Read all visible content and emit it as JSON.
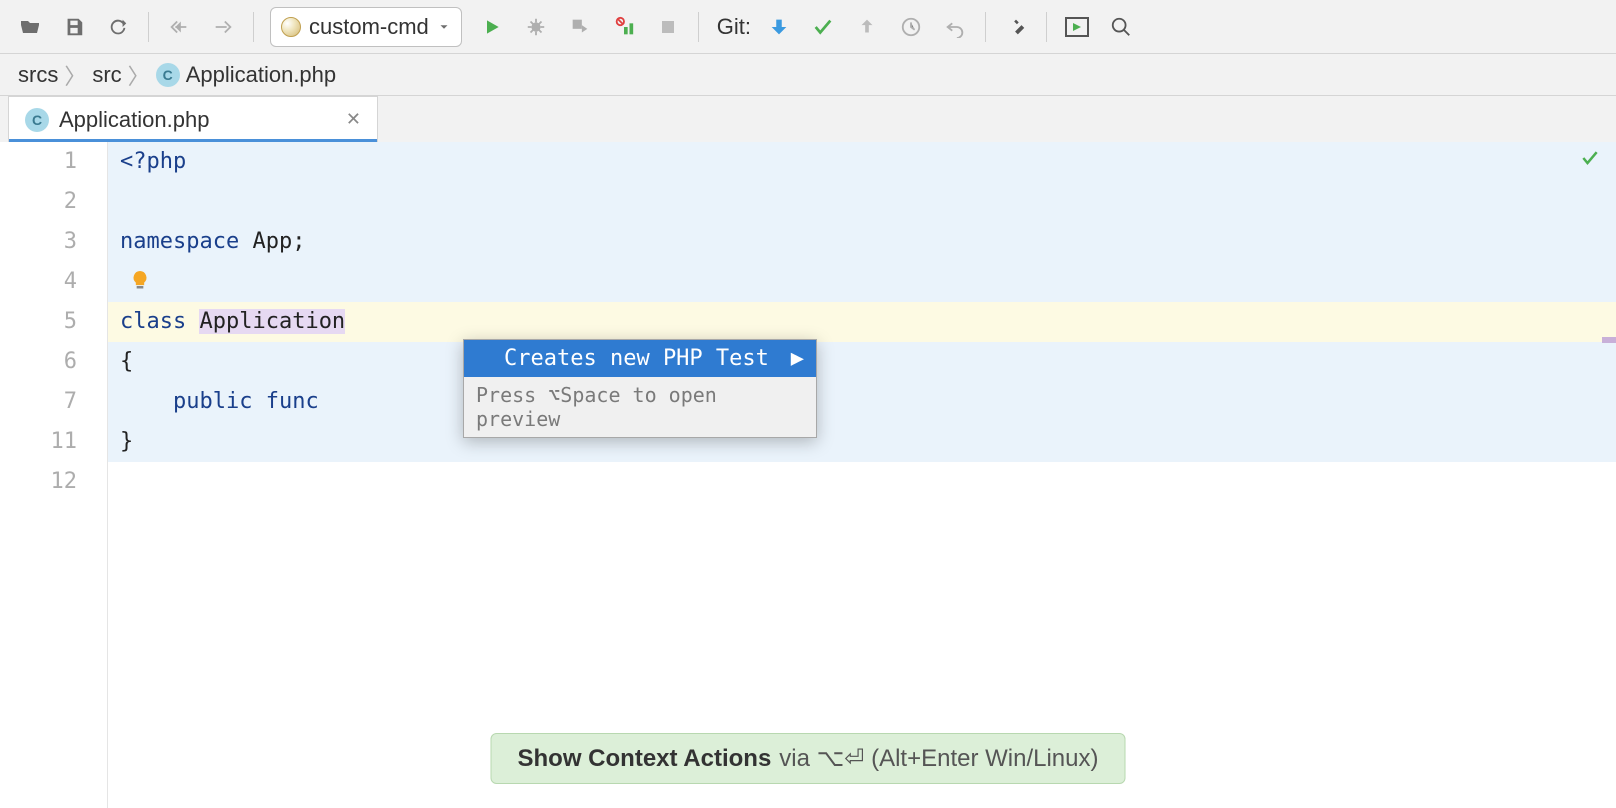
{
  "toolbar": {
    "run_config_label": "custom-cmd",
    "git_label": "Git:"
  },
  "breadcrumbs": {
    "items": [
      "srcs",
      "src",
      "Application.php"
    ]
  },
  "tab": {
    "label": "Application.php"
  },
  "gutter": {
    "lines": [
      "1",
      "2",
      "3",
      "4",
      "5",
      "6",
      "7",
      "11",
      "12"
    ]
  },
  "code": {
    "lines": [
      {
        "segments": [
          {
            "t": "<?php",
            "cls": "kw"
          }
        ],
        "hl": "blue"
      },
      {
        "segments": [
          {
            "t": " ",
            "cls": "plain"
          }
        ],
        "hl": "blue"
      },
      {
        "segments": [
          {
            "t": "namespace ",
            "cls": "kw"
          },
          {
            "t": "App",
            "cls": "plain"
          },
          {
            "t": ";",
            "cls": "punct"
          }
        ],
        "hl": "blue"
      },
      {
        "segments": [
          {
            "t": " ",
            "cls": "plain"
          }
        ],
        "hl": "blue",
        "bulb": true
      },
      {
        "segments": [
          {
            "t": "class ",
            "cls": "kw"
          },
          {
            "t": "Application",
            "cls": "plain sel"
          }
        ],
        "hl": "yellow"
      },
      {
        "segments": [
          {
            "t": "{",
            "cls": "punct"
          }
        ],
        "hl": "blue"
      },
      {
        "segments": [
          {
            "t": "    public ",
            "cls": "kw"
          },
          {
            "t": "func",
            "cls": "kw"
          }
        ],
        "hl": "blue"
      },
      {
        "segments": [
          {
            "t": "}",
            "cls": "punct"
          }
        ],
        "hl": "blue"
      },
      {
        "segments": [
          {
            "t": " ",
            "cls": "plain"
          }
        ]
      }
    ]
  },
  "intention": {
    "item_label": "Creates new PHP Test",
    "hint": "Press ⌥Space to open preview"
  },
  "banner": {
    "strong": "Show Context Actions",
    "rest": " via ⌥⏎ (Alt+Enter Win/Linux)"
  }
}
